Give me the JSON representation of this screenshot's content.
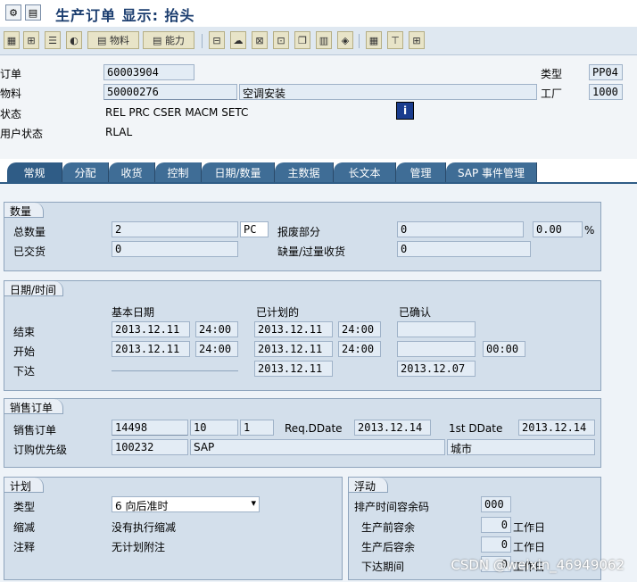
{
  "window": {
    "title": "生产订单 显示: 抬头"
  },
  "toolbar": {
    "material_label": "物料",
    "capacity_label": "能力"
  },
  "header": {
    "order_label": "订单",
    "order_value": "60003904",
    "material_label": "物料",
    "material_value": "50000276",
    "material_desc": "空调安装",
    "status_label": "状态",
    "status_value": "REL  PRC  CSER MACM SETC",
    "user_status_label": "用户状态",
    "user_status_value": "RLAL",
    "type_label": "类型",
    "type_value": "PP04",
    "plant_label": "工厂",
    "plant_value": "1000"
  },
  "tabs": [
    "常规",
    "分配",
    "收货",
    "控制",
    "日期/数量",
    "主数据",
    "长文本",
    "管理",
    "SAP 事件管理"
  ],
  "qty": {
    "title": "数量",
    "total_label": "总数量",
    "total_value": "2",
    "unit": "PC",
    "scrap_label": "报废部分",
    "scrap_value": "0",
    "scrap_pct": "0.00",
    "pct_sign": "%",
    "delivered_label": "已交货",
    "delivered_value": "0",
    "shortage_label": "缺量/过量收货",
    "shortage_value": "0"
  },
  "dates": {
    "title": "日期/时间",
    "col_basic": "基本日期",
    "col_scheduled": "已计划的",
    "col_confirmed": "已确认",
    "finish_label": "结束",
    "finish_basic": "2013.12.11",
    "finish_basic_time": "24:00",
    "finish_sched": "2013.12.11",
    "finish_sched_time": "24:00",
    "start_label": "开始",
    "start_basic": "2013.12.11",
    "start_basic_time": "24:00",
    "start_sched": "2013.12.11",
    "start_sched_time": "24:00",
    "start_conf_time": "00:00",
    "release_label": "下达",
    "release_sched": "2013.12.11",
    "release_conf": "2013.12.07"
  },
  "sales": {
    "title": "销售订单",
    "order_label": "销售订单",
    "order_value": "14498",
    "item_value": "10",
    "sched_value": "1",
    "reqdate_label": "Req.DDate",
    "reqdate_value": "2013.12.14",
    "firstdate_label": "1st DDate",
    "firstdate_value": "2013.12.14",
    "priority_label": "订购优先级",
    "priority_value": "100232",
    "priority_name": "SAP",
    "priority_city": "城市"
  },
  "plan": {
    "title": "计划",
    "type_label": "类型",
    "type_value": "6 向后准时",
    "reduce_label": "缩减",
    "reduce_value": "没有执行缩减",
    "note_label": "注释",
    "note_value": "无计划附注"
  },
  "float": {
    "title": "浮动",
    "margin_key_label": "排产时间容余码",
    "margin_key_value": "000",
    "before_label": "生产前容余",
    "before_value": "0",
    "before_unit": "工作日",
    "after_label": "生产后容余",
    "after_value": "0",
    "after_unit": "工作日",
    "release_label": "下达期间",
    "release_value": "0",
    "release_unit": "工作日"
  },
  "watermark": "CSDN @weixin_46949062"
}
